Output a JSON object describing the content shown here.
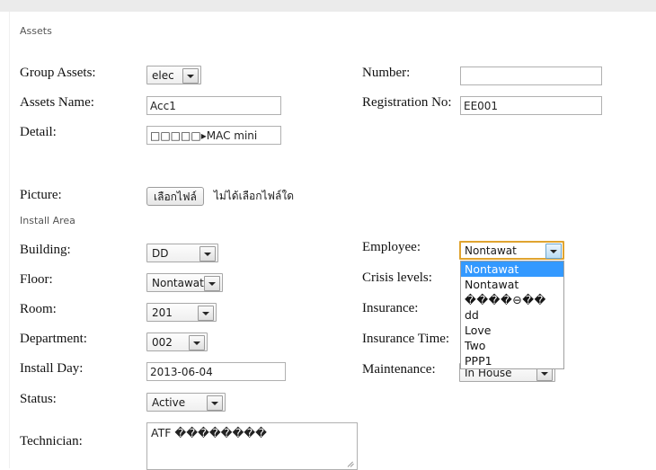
{
  "sections": {
    "assets_legend": "Assets",
    "install_legend": "Install Area"
  },
  "assets": {
    "group_assets": {
      "label": "Group Assets:",
      "value": "elec"
    },
    "assets_name": {
      "label": "Assets Name:",
      "value": "Acc1"
    },
    "detail": {
      "label": "Detail:",
      "value": "□□□□□▸MAC mini"
    },
    "number": {
      "label": "Number:",
      "value": ""
    },
    "registration_no": {
      "label": "Registration No:",
      "value": "EE001"
    },
    "picture": {
      "label": "Picture:",
      "button_label": "เลือกไฟล์",
      "status_text": "ไม่ได้เลือกไฟล์ใด"
    }
  },
  "install": {
    "building": {
      "label": "Building:",
      "value": "DD"
    },
    "floor": {
      "label": "Floor:",
      "value": "Nontawat"
    },
    "room": {
      "label": "Room:",
      "value": "201"
    },
    "department": {
      "label": "Department:",
      "value": "002"
    },
    "install_day": {
      "label": "Install Day:",
      "value": "2013-06-04"
    },
    "status": {
      "label": "Status:",
      "value": "Active"
    },
    "employee": {
      "label": "Employee:",
      "value": "Nontawat",
      "expanded": true,
      "options": [
        "Nontawat",
        "Nontawat",
        "����⊖��",
        "dd",
        "Love",
        "Two",
        "PPP1"
      ],
      "selected_index": 0
    },
    "crisis_levels": {
      "label": "Crisis levels:",
      "value": ""
    },
    "insurance": {
      "label": "Insurance:",
      "value": ""
    },
    "insurance_time": {
      "label": "Insurance Time:",
      "value": ""
    },
    "maintenance": {
      "label": "Maintenance:",
      "value": "In House"
    },
    "technician": {
      "label": "Technician:",
      "value": "ATF ��������"
    }
  },
  "colors": {
    "top_band": "#ebebeb",
    "focus_border": "#e0a430",
    "option_highlight": "#3399ff",
    "input_border": "#b0b0b0"
  }
}
